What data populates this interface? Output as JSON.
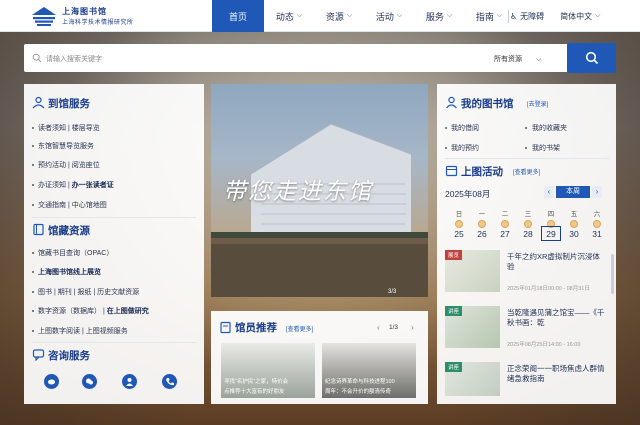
{
  "header": {
    "logo_line1": "上海图书馆",
    "logo_line2": "上海科学技术情报研究所",
    "nav": [
      {
        "label": "首页",
        "active": true,
        "chevron": false
      },
      {
        "label": "动态",
        "chevron": true
      },
      {
        "label": "资源",
        "chevron": true
      },
      {
        "label": "活动",
        "chevron": true
      },
      {
        "label": "服务",
        "chevron": true
      },
      {
        "label": "指南",
        "chevron": true
      }
    ],
    "accessibility": "无障碍",
    "language": "简体中文"
  },
  "search": {
    "placeholder": "请输入搜索关键字",
    "scope": "所有资源"
  },
  "left": {
    "visit_title": "到馆服务",
    "visit_items": [
      [
        "读者须知",
        "楼层导览"
      ],
      [
        "东馆智慧导览服务"
      ],
      [
        "预约活动",
        "阅览座位"
      ],
      [
        "办证须知",
        "办一张读者证"
      ],
      [
        "交通指南",
        "中心馆地图"
      ]
    ],
    "res_title": "馆藏资源",
    "res_items": [
      [
        "馆藏书目查询（OPAC）"
      ],
      [
        "上海图书馆线上展览"
      ],
      [
        "图书",
        "期刊",
        "报纸",
        "历史文献资源"
      ],
      [
        "数字资源（数据库）",
        "在上图做研究"
      ],
      [
        "上图数字阅读",
        "上图视频服务"
      ]
    ],
    "consult_title": "咨询服务"
  },
  "hero": {
    "caption": "带您走进东馆",
    "page": "3/3"
  },
  "recommend": {
    "title": "馆员推荐",
    "more": "[查看更多]",
    "page": "1/3",
    "cards": [
      {
        "line1": "寻找“名护民”之家，特价会",
        "line2": "点推荐十大富有的好朋友"
      },
      {
        "line1": "纪念诗界革命与科技进程100",
        "line2": "周年：不会升价的额清传奇"
      }
    ]
  },
  "right": {
    "my_title": "我的图书馆",
    "my_more": "[去登录]",
    "my_items": [
      "我的借阅",
      "我的收藏夹",
      "我的预约",
      "我的书架"
    ],
    "act_title": "上图活动",
    "act_more": "[查看更多]",
    "month": "2025年08月",
    "this_week": "本周",
    "weekdays": [
      "日",
      "一",
      "二",
      "三",
      "四",
      "五",
      "六"
    ],
    "days": [
      "25",
      "26",
      "27",
      "28",
      "29",
      "30",
      "31"
    ],
    "events": [
      {
        "tag": "展览",
        "title": "千年之约XR虚拟制片沉浸体验",
        "date": "2025年01月18日00:00 - 08月31日"
      },
      {
        "tag": "讲座",
        "title": "当乾隆遇见蒲之馆宝——《千秋书画：乾",
        "date": "2025年08月25日14:00 - 16:00"
      },
      {
        "tag": "讲座",
        "title": "正念荣阁一一职场焦虑人群情绪急救指南",
        "date": ""
      }
    ]
  },
  "colors": {
    "primary": "#1f58b6",
    "title": "#1a3c8c"
  }
}
